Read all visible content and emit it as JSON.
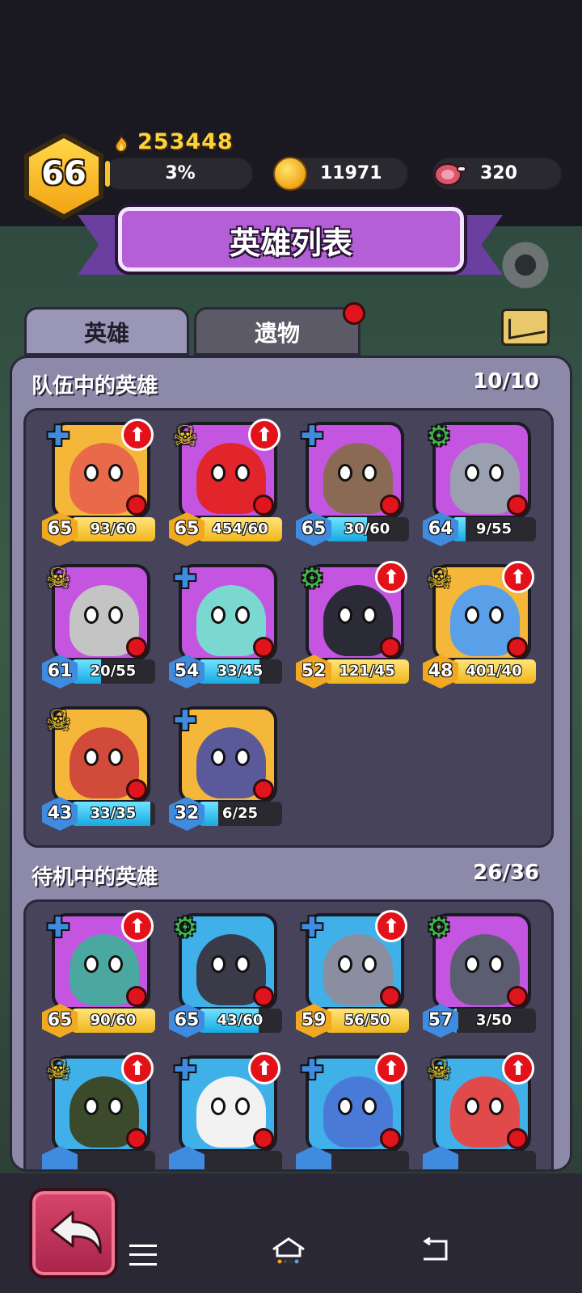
{
  "player": {
    "level": "66",
    "power": "253448",
    "exp_percent": "3%",
    "exp_fraction": 0.03,
    "gold": "11971",
    "meat": "320"
  },
  "banner": {
    "title": "英雄列表"
  },
  "tabs": [
    {
      "label": "英雄",
      "active": true
    },
    {
      "label": "遗物",
      "active": false,
      "has_notification": true
    }
  ],
  "team_section": {
    "title": "队伍中的英雄",
    "count": "10/10",
    "heroes": [
      {
        "level": "65",
        "progress": "93/60",
        "fill": 1.0,
        "style": "gold",
        "class_icon": "blue-cross",
        "upgrade": true,
        "bg": "#f5b73a",
        "face": "#e86a4a"
      },
      {
        "level": "65",
        "progress": "454/60",
        "fill": 1.0,
        "style": "gold",
        "class_icon": "yellow-skull",
        "upgrade": true,
        "bg": "#c455e0",
        "face": "#e2252a"
      },
      {
        "level": "65",
        "progress": "30/60",
        "fill": 0.5,
        "style": "blue",
        "class_icon": "blue-cross",
        "upgrade": false,
        "bg": "#c455e0",
        "face": "#8a6a55"
      },
      {
        "level": "64",
        "progress": "9/55",
        "fill": 0.16,
        "style": "blue",
        "class_icon": "green-gear",
        "upgrade": false,
        "bg": "#c455e0",
        "face": "#9aa0b0"
      },
      {
        "level": "61",
        "progress": "20/55",
        "fill": 0.36,
        "style": "blue",
        "class_icon": "yellow-skull",
        "upgrade": false,
        "bg": "#c455e0",
        "face": "#c4c4c4"
      },
      {
        "level": "54",
        "progress": "33/45",
        "fill": 0.73,
        "style": "blue",
        "class_icon": "blue-cross",
        "upgrade": false,
        "bg": "#c455e0",
        "face": "#7ad8d0"
      },
      {
        "level": "52",
        "progress": "121/45",
        "fill": 1.0,
        "style": "gold",
        "class_icon": "green-gear",
        "upgrade": true,
        "bg": "#c455e0",
        "face": "#2b2b38"
      },
      {
        "level": "48",
        "progress": "401/40",
        "fill": 1.0,
        "style": "gold",
        "class_icon": "yellow-skull",
        "upgrade": true,
        "bg": "#f5b73a",
        "face": "#5aa0e8"
      },
      {
        "level": "43",
        "progress": "33/35",
        "fill": 0.94,
        "style": "blue",
        "class_icon": "yellow-skull",
        "upgrade": false,
        "bg": "#f5b73a",
        "face": "#d24a3a"
      },
      {
        "level": "32",
        "progress": "6/25",
        "fill": 0.24,
        "style": "blue",
        "class_icon": "blue-cross",
        "upgrade": false,
        "bg": "#f5b73a",
        "face": "#5a5a9a"
      }
    ]
  },
  "standby_section": {
    "title": "待机中的英雄",
    "count": "26/36",
    "heroes": [
      {
        "level": "65",
        "progress": "90/60",
        "fill": 1.0,
        "style": "gold",
        "class_icon": "blue-cross",
        "upgrade": true,
        "bg": "#c455e0",
        "face": "#4aa8a0"
      },
      {
        "level": "65",
        "progress": "43/60",
        "fill": 0.72,
        "style": "blue",
        "class_icon": "green-gear",
        "upgrade": false,
        "bg": "#3fb0e8",
        "face": "#3a3a48"
      },
      {
        "level": "59",
        "progress": "56/50",
        "fill": 1.0,
        "style": "gold",
        "class_icon": "blue-cross",
        "upgrade": true,
        "bg": "#3fb0e8",
        "face": "#8a8ea0"
      },
      {
        "level": "57",
        "progress": "3/50",
        "fill": 0.06,
        "style": "blue",
        "class_icon": "green-gear",
        "upgrade": false,
        "bg": "#c455e0",
        "face": "#5a5e70"
      },
      {
        "level": "",
        "progress": "",
        "fill": 0,
        "style": "blue",
        "class_icon": "yellow-skull",
        "upgrade": true,
        "bg": "#3fb0e8",
        "face": "#3a4a2a"
      },
      {
        "level": "",
        "progress": "",
        "fill": 0,
        "style": "blue",
        "class_icon": "blue-cross",
        "upgrade": true,
        "bg": "#3fb0e8",
        "face": "#f2f2f2"
      },
      {
        "level": "",
        "progress": "",
        "fill": 0,
        "style": "blue",
        "class_icon": "blue-cross",
        "upgrade": true,
        "bg": "#3fb0e8",
        "face": "#4a7ad8"
      },
      {
        "level": "",
        "progress": "",
        "fill": 0,
        "style": "blue",
        "class_icon": "yellow-skull",
        "upgrade": true,
        "bg": "#3fb0e8",
        "face": "#e04a4a"
      }
    ]
  },
  "icons": {
    "class_blue": "✚",
    "class_yellow": "☠",
    "class_green": "⚙",
    "upgrade": "⬆"
  },
  "colors": {
    "accent_purple": "#b55fd6",
    "gold": "#f2a922",
    "blue": "#3f8be0",
    "badge_red": "#e0141c"
  }
}
